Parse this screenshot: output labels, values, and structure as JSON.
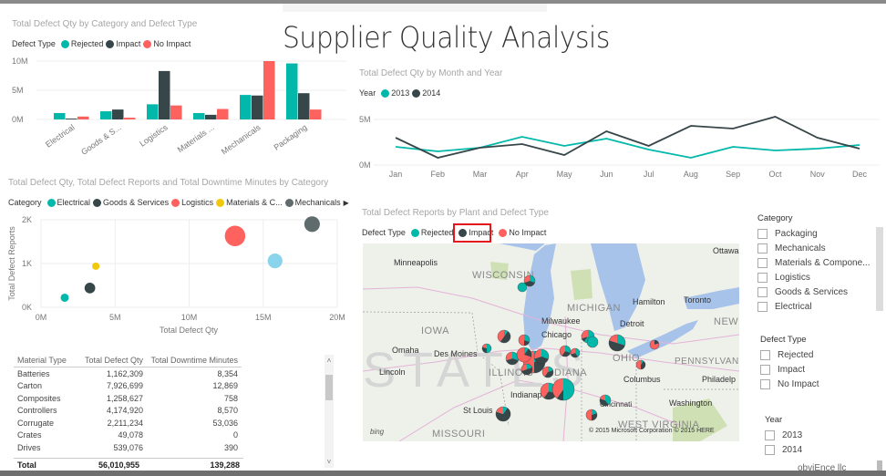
{
  "page": {
    "title": "Supplier Quality Analysis",
    "footer": "obviEnce llc"
  },
  "colors": {
    "rejected": "#01B8AA",
    "impact": "#374649",
    "no_impact": "#FD625E",
    "electrical": "#01B8AA",
    "goods_services": "#374649",
    "logistics": "#FD625E",
    "materials": "#F2C80F",
    "mechanicals": "#5F6B6D",
    "packaging": "#8AD4EB",
    "y2013": "#01B8AA",
    "y2014": "#374649"
  },
  "bar_visual": {
    "title": "Total Defect Qty by Category and Defect Type",
    "legend_label": "Defect Type",
    "legend": [
      "Rejected",
      "Impact",
      "No Impact"
    ]
  },
  "line_visual": {
    "title": "Total Defect Qty by Month and Year",
    "legend_label": "Year",
    "legend": [
      "2013",
      "2014"
    ]
  },
  "scatter_visual": {
    "title": "Total Defect Qty, Total Defect Reports and Total Downtime Minutes by Category",
    "legend_label": "Category",
    "legend": [
      "Electrical",
      "Goods & Services",
      "Logistics",
      "Materials & C...",
      "Mechanicals"
    ],
    "legend_more": "▶"
  },
  "map_visual": {
    "title": "Total Defect Reports by Plant and Defect Type",
    "legend_label": "Defect Type",
    "legend": [
      "Rejected",
      "Impact",
      "No Impact"
    ],
    "labels": {
      "ottawa": "Ottawa",
      "minneapolis": "Minneapolis",
      "wisconsin": "WISCONSIN",
      "michigan": "MICHIGAN",
      "hamilton": "Hamilton",
      "toronto": "Toronto",
      "milwaukee": "Milwaukee",
      "detroit": "Detroit",
      "new_york": "NEW Y",
      "iowa": "IOWA",
      "chicago": "Chicago",
      "omaha": "Omaha",
      "des_moines": "Des Moines",
      "ohio": "OHIO",
      "pennsylvania": "PENNSYLVANIA",
      "lincoln": "Lincoln",
      "illinois": "ILLINOIS",
      "indiana": "INDIANA",
      "columbus": "Columbus",
      "philadelphia": "Philadelp",
      "indianapolis": "Indianapolis",
      "cincinnati": "Cincinnati",
      "washington": "Washington",
      "st_louis": "St Louis",
      "west_virginia": "WEST VIRGINIA",
      "missouri": "MISSOURI",
      "states_watermark": "STATES",
      "bing": "bing",
      "copyright": "© 2015 Microsoft Corporation   © 2015 HERE"
    }
  },
  "table_visual": {
    "columns": [
      "Material Type",
      "Total Defect Qty",
      "Total Downtime Minutes"
    ],
    "rows": [
      [
        "Batteries",
        "1,162,309",
        "8,354"
      ],
      [
        "Carton",
        "7,926,699",
        "12,869"
      ],
      [
        "Composites",
        "1,258,627",
        "758"
      ],
      [
        "Controllers",
        "4,174,920",
        "8,570"
      ],
      [
        "Corrugate",
        "2,211,234",
        "53,036"
      ],
      [
        "Crates",
        "49,078",
        "0"
      ],
      [
        "Drives",
        "539,076",
        "390"
      ]
    ],
    "total": [
      "Total",
      "56,010,955",
      "139,288"
    ],
    "scroll_up": "˄",
    "scroll_down": "˅"
  },
  "slicers": {
    "category": {
      "header": "Category",
      "items": [
        "Packaging",
        "Mechanicals",
        "Materials & Compone...",
        "Logistics",
        "Goods & Services",
        "Electrical"
      ]
    },
    "defect_type": {
      "header": "Defect Type",
      "items": [
        "Rejected",
        "Impact",
        "No Impact"
      ]
    },
    "year": {
      "header": "Year",
      "items": [
        "2013",
        "2014"
      ]
    }
  },
  "chart_data": [
    {
      "type": "bar",
      "title": "Total Defect Qty by Category and Defect Type",
      "categories": [
        "Electrical",
        "Goods & S...",
        "Logistics",
        "Materials ...",
        "Mechanicals",
        "Packaging"
      ],
      "series": [
        {
          "name": "Rejected",
          "values": [
            1.1,
            1.4,
            2.6,
            1.1,
            4.2,
            9.6
          ]
        },
        {
          "name": "Impact",
          "values": [
            0.15,
            1.7,
            8.3,
            0.8,
            4.1,
            4.5
          ]
        },
        {
          "name": "No Impact",
          "values": [
            0.5,
            0.3,
            2.4,
            1.8,
            10.0,
            1.7
          ]
        }
      ],
      "unit": "M",
      "ylim": [
        0,
        10
      ],
      "yticks": [
        "0M",
        "5M",
        "10M"
      ],
      "grid": true,
      "legend": "top-left"
    },
    {
      "type": "line",
      "title": "Total Defect Qty by Month and Year",
      "x": [
        "Jan",
        "Feb",
        "Mar",
        "Apr",
        "May",
        "Jun",
        "Jul",
        "Aug",
        "Sep",
        "Oct",
        "Nov",
        "Dec"
      ],
      "series": [
        {
          "name": "2013",
          "values": [
            2.0,
            1.5,
            1.9,
            3.1,
            2.1,
            2.9,
            1.7,
            0.8,
            2.0,
            1.6,
            1.8,
            2.2
          ]
        },
        {
          "name": "2014",
          "values": [
            3.0,
            0.8,
            1.9,
            2.3,
            1.1,
            3.7,
            2.1,
            4.3,
            4.0,
            5.3,
            3.0,
            1.8
          ]
        }
      ],
      "unit": "M",
      "ylim": [
        0,
        6
      ],
      "yticks": [
        "0M",
        "5M"
      ],
      "grid": true,
      "legend": "top-left"
    },
    {
      "type": "scatter",
      "title": "Total Defect Qty, Total Defect Reports and Total Downtime Minutes by Category",
      "xlabel": "Total Defect Qty",
      "ylabel": "Total Defect Reports",
      "xlim": [
        0,
        20
      ],
      "ylim": [
        0,
        2
      ],
      "xticks": [
        "0M",
        "5M",
        "10M",
        "15M",
        "20M"
      ],
      "yticks": [
        "0K",
        "1K",
        "2K"
      ],
      "points": [
        {
          "name": "Electrical",
          "x": 1.6,
          "y": 0.22,
          "size": 1.0
        },
        {
          "name": "Goods & Services",
          "x": 3.3,
          "y": 0.44,
          "size": 1.3
        },
        {
          "name": "Materials & Components",
          "x": 3.7,
          "y": 0.94,
          "size": 0.9
        },
        {
          "name": "Logistics",
          "x": 13.1,
          "y": 1.63,
          "size": 2.5
        },
        {
          "name": "Packaging",
          "x": 15.8,
          "y": 1.06,
          "size": 1.8
        },
        {
          "name": "Mechanicals",
          "x": 18.3,
          "y": 1.9,
          "size": 1.9
        }
      ],
      "grid": true,
      "legend": "top-left"
    }
  ]
}
